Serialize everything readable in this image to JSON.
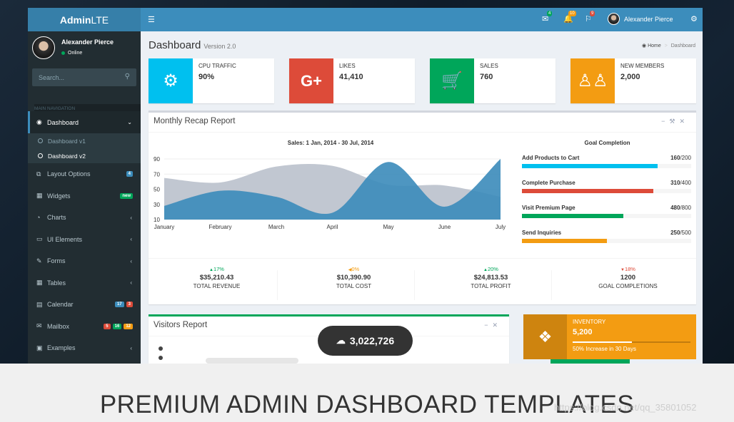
{
  "app": {
    "logo_bold": "Admin",
    "logo_light": "LTE"
  },
  "header": {
    "user_name": "Alexander Pierce",
    "badges": {
      "messages": "4",
      "notifications": "10",
      "tasks": "9"
    }
  },
  "sidebar": {
    "user_name": "Alexander Pierce",
    "status": "Online",
    "search_placeholder": "Search...",
    "nav_header": "MAIN NAVIGATION",
    "items": [
      {
        "label": "Dashboard",
        "icon": "dashboard-icon",
        "active": true
      },
      {
        "label": "Layout Options",
        "icon": "files-icon",
        "badges": [
          {
            "text": "4",
            "color": "#3c8dbc"
          }
        ]
      },
      {
        "label": "Widgets",
        "icon": "th-icon",
        "badges": [
          {
            "text": "new",
            "color": "#00a65a"
          }
        ]
      },
      {
        "label": "Charts",
        "icon": "pie-chart-icon"
      },
      {
        "label": "UI Elements",
        "icon": "laptop-icon"
      },
      {
        "label": "Forms",
        "icon": "edit-icon"
      },
      {
        "label": "Tables",
        "icon": "table-icon"
      },
      {
        "label": "Calendar",
        "icon": "calendar-icon",
        "badges": [
          {
            "text": "17",
            "color": "#3c8dbc"
          },
          {
            "text": "3",
            "color": "#dd4b39"
          }
        ]
      },
      {
        "label": "Mailbox",
        "icon": "envelope-icon",
        "badges": [
          {
            "text": "5",
            "color": "#dd4b39"
          },
          {
            "text": "16",
            "color": "#00a65a"
          },
          {
            "text": "12",
            "color": "#f39c12"
          }
        ]
      },
      {
        "label": "Examples",
        "icon": "folder-icon"
      }
    ],
    "sub_items": [
      "Dashboard v1",
      "Dashboard v2"
    ]
  },
  "page": {
    "title": "Dashboard",
    "version": "Version 2.0",
    "breadcrumb_home": "Home",
    "breadcrumb_current": "Dashboard"
  },
  "info_boxes": [
    {
      "label": "CPU TRAFFIC",
      "value": "90%",
      "color": "#00c0ef",
      "icon": "gear-icon"
    },
    {
      "label": "LIKES",
      "value": "41,410",
      "color": "#dd4b39",
      "icon": "google-plus-icon"
    },
    {
      "label": "SALES",
      "value": "760",
      "color": "#00a65a",
      "icon": "shopping-cart-icon"
    },
    {
      "label": "NEW MEMBERS",
      "value": "2,000",
      "color": "#f39c12",
      "icon": "users-icon"
    }
  ],
  "monthly": {
    "title": "Monthly Recap Report",
    "goal_title": "Goal Completion",
    "goals": [
      {
        "label": "Add Products to Cart",
        "done": "160",
        "total": "/200",
        "color": "#00c0ef",
        "fraction": 0.8
      },
      {
        "label": "Complete Purchase",
        "done": "310",
        "total": "/400",
        "color": "#dd4b39",
        "fraction": 0.775
      },
      {
        "label": "Visit Premium Page",
        "done": "480",
        "total": "/800",
        "color": "#00a65a",
        "fraction": 0.6
      },
      {
        "label": "Send Inquiries",
        "done": "250",
        "total": "/500",
        "color": "#f39c12",
        "fraction": 0.5
      }
    ],
    "footer": [
      {
        "pct": "17%",
        "dir": "up",
        "color": "#00a65a",
        "amount": "$35,210.43",
        "label": "TOTAL REVENUE"
      },
      {
        "pct": "0%",
        "dir": "left",
        "color": "#f39c12",
        "amount": "$10,390.90",
        "label": "TOTAL COST"
      },
      {
        "pct": "20%",
        "dir": "up",
        "color": "#00a65a",
        "amount": "$24,813.53",
        "label": "TOTAL PROFIT"
      },
      {
        "pct": "18%",
        "dir": "down",
        "color": "#dd4b39",
        "amount": "1200",
        "label": "GOAL COMPLETIONS"
      }
    ]
  },
  "chart_data": {
    "type": "area",
    "title": "Sales: 1 Jan, 2014 - 30 Jul, 2014",
    "categories": [
      "January",
      "February",
      "March",
      "April",
      "May",
      "June",
      "July"
    ],
    "yticks": [
      10,
      30,
      50,
      70,
      90
    ],
    "ylim": [
      10,
      90
    ],
    "grid": true,
    "series": [
      {
        "color": "#c1c7d1",
        "values": [
          65,
          59,
          80,
          81,
          56,
          55,
          40
        ]
      },
      {
        "color": "#3b8bba",
        "values": [
          28,
          48,
          40,
          19,
          86,
          27,
          90
        ]
      }
    ]
  },
  "visitors": {
    "title": "Visitors Report"
  },
  "inventory": {
    "label": "INVENTORY",
    "value": "5,200",
    "desc": "50% Increase in 30 Days",
    "progress": 0.5
  },
  "overlay": {
    "count": "3,022,726"
  },
  "banner": {
    "title": "PREMIUM ADMIN DASHBOARD TEMPLATES",
    "watermark": "https://blog.csdn.net/qq_35801052"
  }
}
